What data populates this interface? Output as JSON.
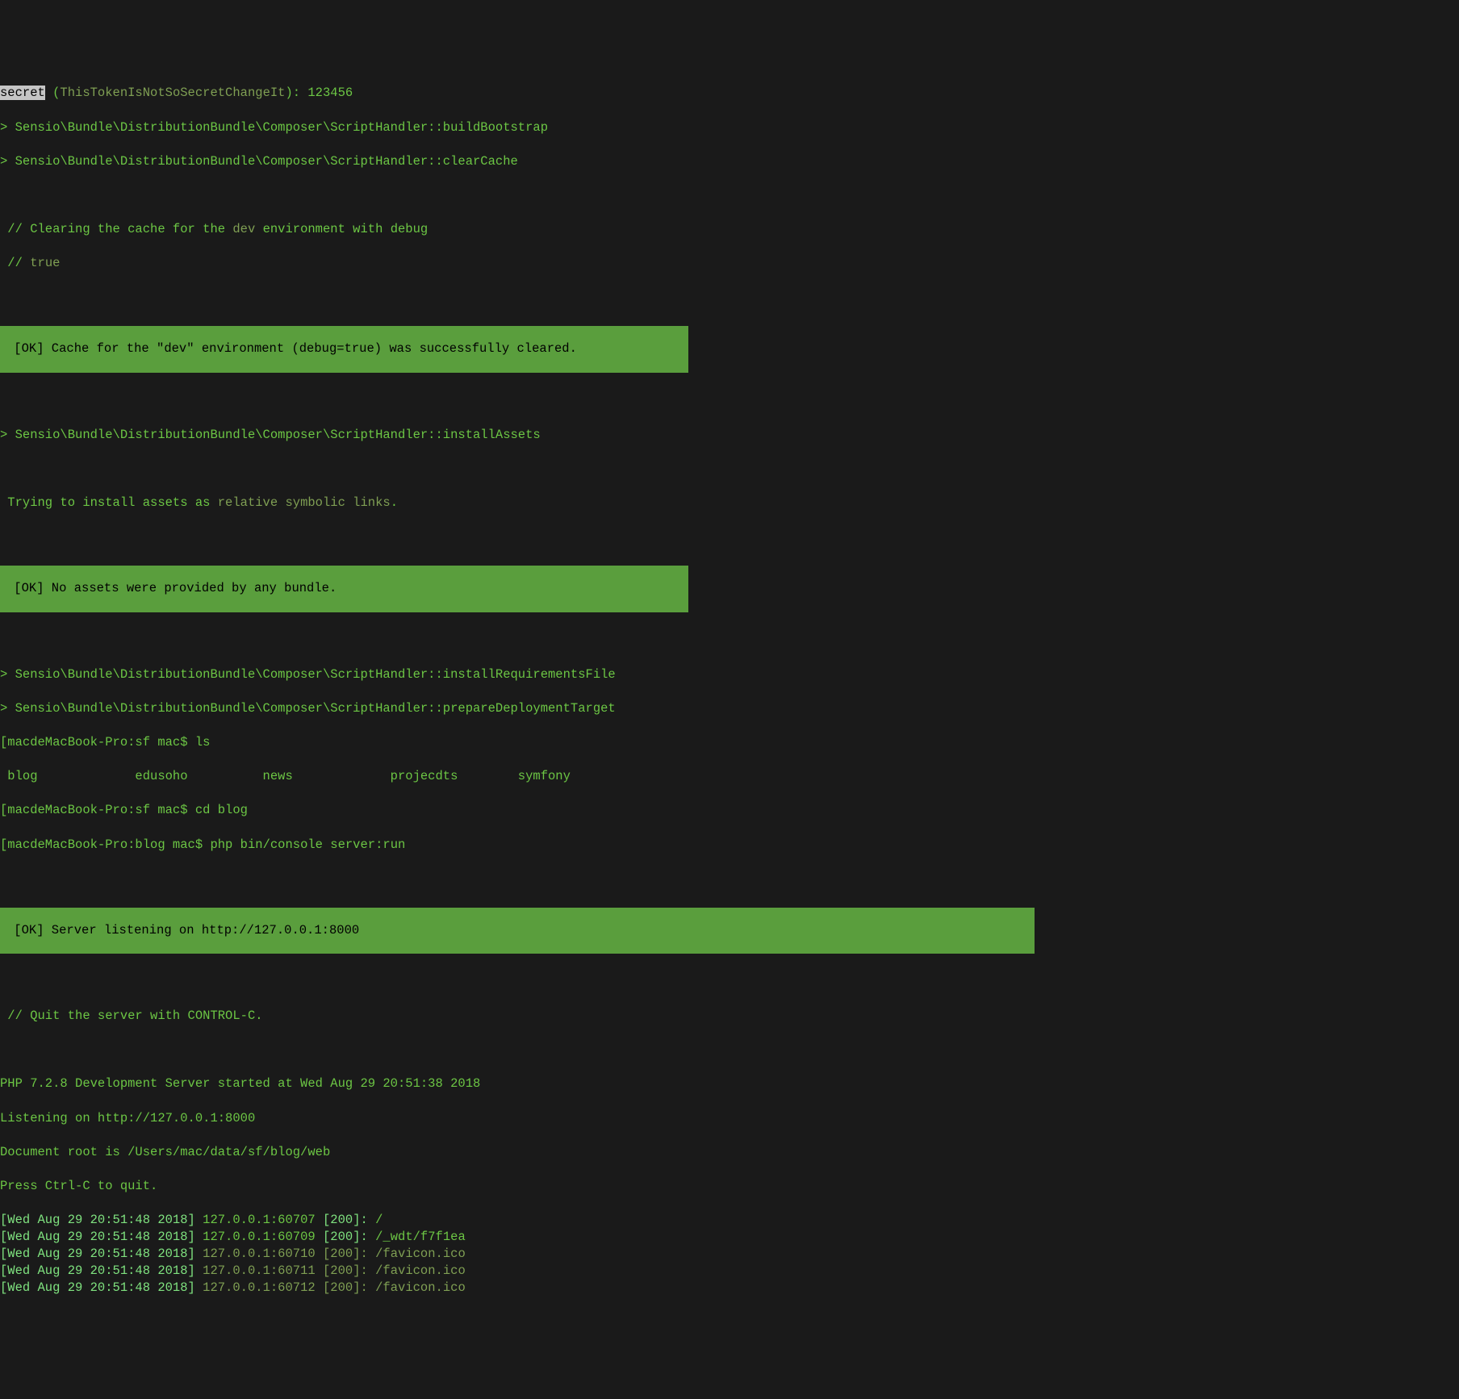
{
  "line1": {
    "selected": "secret",
    "paren_open": " (",
    "token": "ThisTokenIsNotSoSecretChangeIt",
    "paren_close_colon": "): ",
    "value": "123456"
  },
  "l2": "> Sensio\\Bundle\\DistributionBundle\\Composer\\ScriptHandler::buildBootstrap",
  "l3": "> Sensio\\Bundle\\DistributionBundle\\Composer\\ScriptHandler::clearCache",
  "l4": {
    "pre": " // Clearing the cache for the ",
    "kw": "dev",
    "post": " environment with debug"
  },
  "l5": {
    "pre": " // ",
    "kw": "true"
  },
  "ok1": " [OK] Cache for the \"dev\" environment (debug=true) was successfully cleared.      ",
  "l6": "> Sensio\\Bundle\\DistributionBundle\\Composer\\ScriptHandler::installAssets",
  "l7": {
    "pre": " Trying to install assets as ",
    "kw": "relative symbolic links",
    "post": "."
  },
  "ok2": " [OK] No assets were provided by any bundle.                                        ",
  "l8": "> Sensio\\Bundle\\DistributionBundle\\Composer\\ScriptHandler::installRequirementsFile",
  "l9": "> Sensio\\Bundle\\DistributionBundle\\Composer\\ScriptHandler::prepareDeploymentTarget",
  "p1": {
    "host": "[macdeMacBook-Pro:sf mac$ ",
    "cmd": "ls"
  },
  "ls_cols": [
    "blog",
    "edusoho",
    "news",
    "projecdts",
    "symfony"
  ],
  "p2": {
    "host": "[macdeMacBook-Pro:sf mac$ ",
    "cmd": "cd blog"
  },
  "p3": {
    "host": "[macdeMacBook-Pro:blog mac$ ",
    "cmd": "php bin/console server:run"
  },
  "ok3": " [OK] Server listening on http://127.0.0.1:8000                                                                              ",
  "l10": " // Quit the server with CONTROL-C.",
  "l11": "PHP 7.2.8 Development Server started at Wed Aug 29 20:51:38 2018",
  "l12": "Listening on http://127.0.0.1:8000",
  "l13": "Document root is /Users/mac/data/sf/blog/web",
  "l14": "Press Ctrl-C to quit.",
  "reqs": [
    {
      "ts": "[Wed Aug 29 20:51:48 2018]",
      "addr": "127.0.0.1:60707",
      "code": "[200]:",
      "path": "/",
      "dim": false
    },
    {
      "ts": "[Wed Aug 29 20:51:48 2018]",
      "addr": "127.0.0.1:60709",
      "code": "[200]:",
      "path": "/_wdt/f7f1ea",
      "dim": false
    },
    {
      "ts": "[Wed Aug 29 20:51:48 2018]",
      "addr": "127.0.0.1:60710",
      "code": "[200]:",
      "path": "/favicon.ico",
      "dim": true
    },
    {
      "ts": "[Wed Aug 29 20:51:48 2018]",
      "addr": "127.0.0.1:60711",
      "code": "[200]:",
      "path": "/favicon.ico",
      "dim": true
    },
    {
      "ts": "[Wed Aug 29 20:51:48 2018]",
      "addr": "127.0.0.1:60712",
      "code": "[200]:",
      "path": "/favicon.ico",
      "dim": true
    }
  ]
}
